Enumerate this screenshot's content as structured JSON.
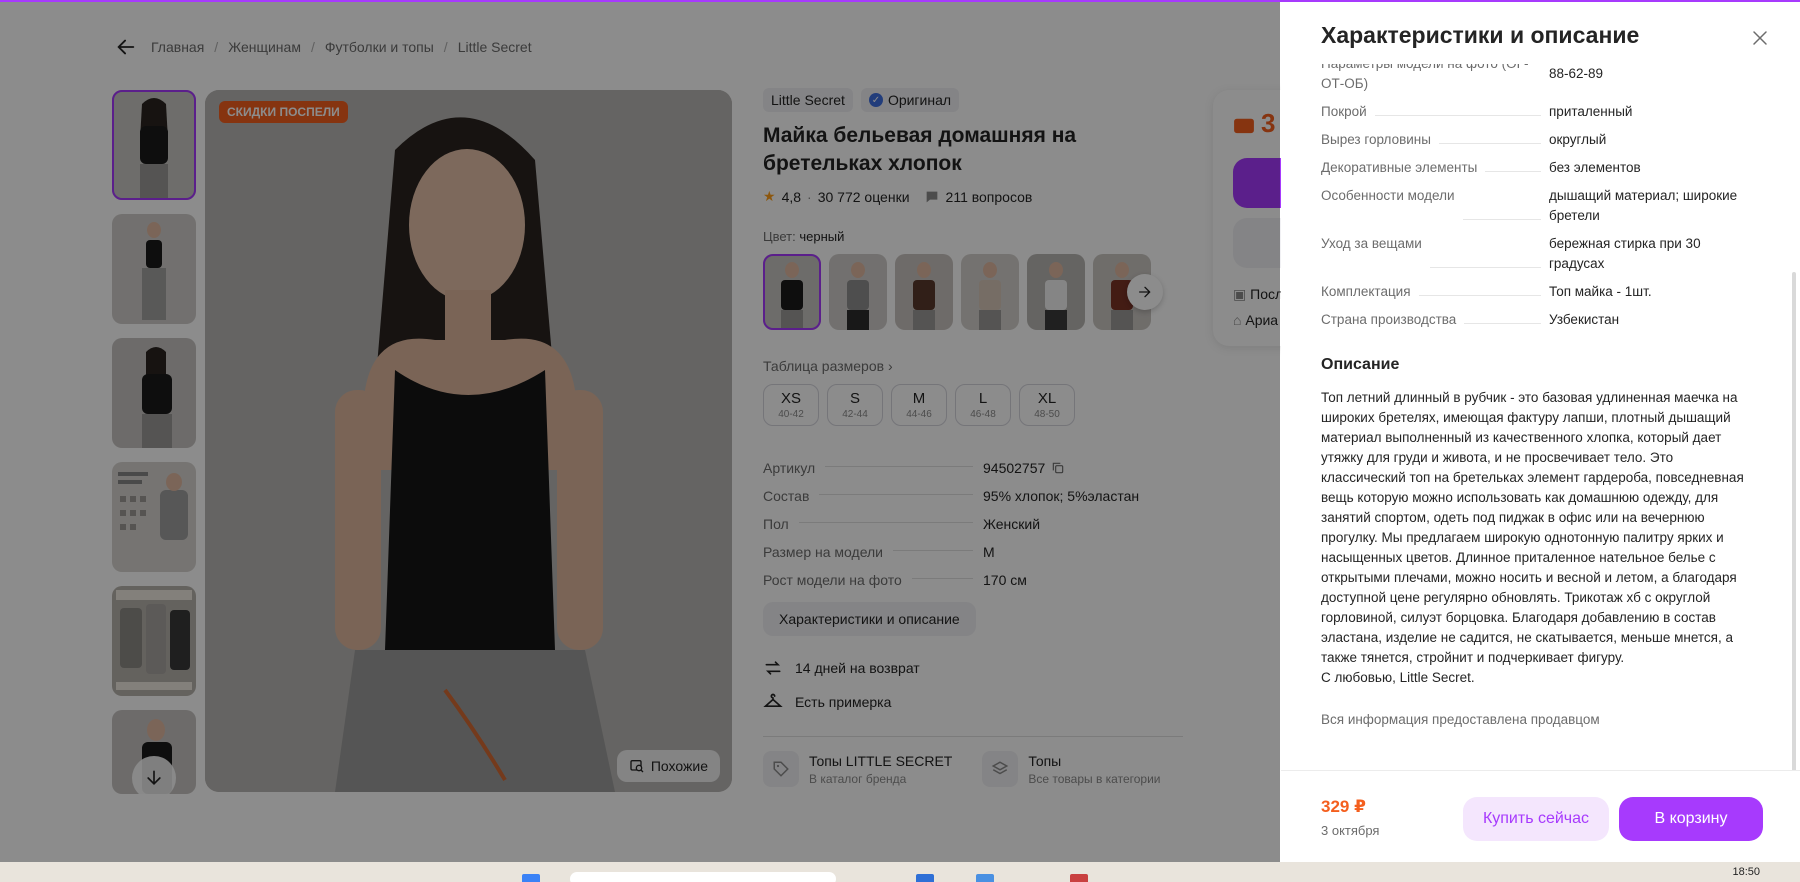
{
  "breadcrumb": {
    "items": [
      "Главная",
      "Женщинам",
      "Футболки и топы",
      "Little Secret"
    ],
    "sep": "/"
  },
  "gallery": {
    "promo_badge": "СКИДКИ ПОСПЕЛИ",
    "similar_label": "Похожие"
  },
  "product": {
    "brand": "Little Secret",
    "original_label": "Оригинал",
    "title": "Майка бельевая домашняя на бретельках хлопок",
    "rating": "4,8",
    "dot": "·",
    "ratings_count": "30 772 оценки",
    "questions": "211 вопросов",
    "color_prefix": "Цвет:",
    "color_value": "черный",
    "size_table_label": "Таблица размеров",
    "sizes": [
      {
        "size": "XS",
        "range": "40-42"
      },
      {
        "size": "S",
        "range": "42-44"
      },
      {
        "size": "M",
        "range": "44-46"
      },
      {
        "size": "L",
        "range": "46-48"
      },
      {
        "size": "XL",
        "range": "48-50"
      }
    ],
    "params": [
      {
        "k": "Артикул",
        "v": "94502757"
      },
      {
        "k": "Состав",
        "v": "95% хлопок; 5%эластан"
      },
      {
        "k": "Пол",
        "v": "Женский"
      },
      {
        "k": "Размер на модели",
        "v": "M"
      },
      {
        "k": "Рост модели на фото",
        "v": "170 см"
      }
    ],
    "desc_button": "Характеристики и описание",
    "return_label": "14 дней на возврат",
    "fitting_label": "Есть примерка",
    "categories": [
      {
        "title": "Топы LITTLE SECRET",
        "sub": "В каталог бренда"
      },
      {
        "title": "Топы",
        "sub": "Все товары в категории"
      }
    ]
  },
  "buy_card": {
    "price_fragment": "3",
    "line1": "Посл",
    "line2": "Ариа"
  },
  "drawer": {
    "title": "Характеристики и описание",
    "specs": [
      {
        "k": "Параметры модели на фото (ОГ-ОТ-ОБ)",
        "v": "88-62-89"
      },
      {
        "k": "Покрой",
        "v": "приталенный"
      },
      {
        "k": "Вырез горловины",
        "v": "округлый"
      },
      {
        "k": "Декоративные элементы",
        "v": "без элементов"
      },
      {
        "k": "Особенности модели",
        "v": "дышащий материал; широкие бретели"
      },
      {
        "k": "Уход за вещами",
        "v": "бережная стирка при 30 градусах"
      },
      {
        "k": "Комплектация",
        "v": "Топ майка - 1шт."
      },
      {
        "k": "Страна производства",
        "v": "Узбекистан"
      }
    ],
    "desc_heading": "Описание",
    "description": "Топ летний длинный в рубчик - это базовая удлиненная маечка на широких бретелях, имеющая фактуру лапши, плотный дышащий материал выполненный из качественного хлопка, который дает утяжку для груди и живота, и не просвечивает тело. Это классический топ на бретельках элемент гардероба, повседневная вещь которую можно использовать как домашнюю одежду, для занятий спортом, одеть под пиджак в офис или на вечернюю прогулку. Мы предлагаем широкую однотонную палитру ярких и насыщенных цветов. Длинное приталенное нательное белье с открытыми плечами, можно носить и весной и летом, а благодаря доступной цене регулярно обновлять. Трикотаж хб с округлой горловиной, силуэт борцовка. Благодаря добавлению в состав эластана, изделие не садится, не скатывается, меньше мнется, а также тянется, стройнит и подчеркивает фигуру.\nС любовью, Little Secret.",
    "seller_note": "Вся информация предоставлена продавцом",
    "footer": {
      "price": "329 ₽",
      "date": "3 октября",
      "buy_now": "Купить сейчас",
      "to_cart": "В корзину"
    }
  },
  "taskbar": {
    "time": "18:50"
  },
  "colors": {
    "accent": "#a73afd",
    "price": "#f45f1e",
    "overlay": "rgba(0,0,0,0.45)"
  }
}
